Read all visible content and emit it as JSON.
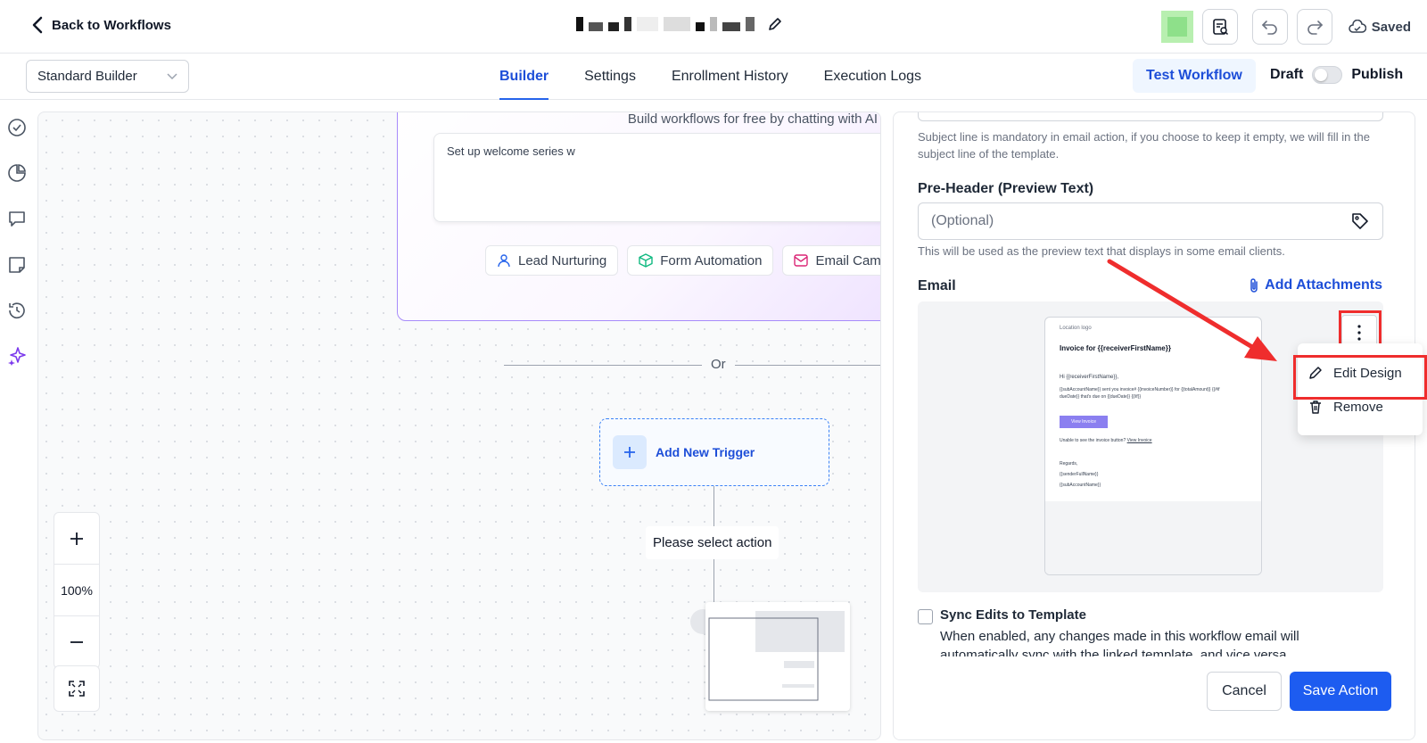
{
  "header": {
    "back_label": "Back to Workflows",
    "saved_label": "Saved",
    "brand_color": "#8ee08a"
  },
  "subbar": {
    "builder_select": "Standard Builder",
    "tabs": [
      {
        "label": "Builder",
        "active": true
      },
      {
        "label": "Settings",
        "active": false
      },
      {
        "label": "Enrollment History",
        "active": false
      },
      {
        "label": "Execution Logs",
        "active": false
      }
    ],
    "test_button": "Test Workflow",
    "draft_label": "Draft",
    "publish_label": "Publish"
  },
  "rail": {
    "icons": [
      "check-circle-icon",
      "pie-chart-icon",
      "chat-icon",
      "note-icon",
      "history-icon",
      "sparkle-icon"
    ]
  },
  "canvas": {
    "ai_subtitle": "Build workflows for free by chatting with AI",
    "ai_input_value": "Set up welcome series w",
    "chips": [
      "Lead Nurturing",
      "Form Automation",
      "Email Cam"
    ],
    "or_label": "Or",
    "add_trigger_label": "Add New Trigger",
    "select_action_label": "Please select action",
    "zoom_level": "100%"
  },
  "panel": {
    "subject_help": "Subject line is mandatory in email action, if you choose to keep it empty, we will fill in the subject line of the template.",
    "preheader_label": "Pre-Header (Preview Text)",
    "preheader_placeholder": "(Optional)",
    "preheader_help": "This will be used as the preview text that displays in some email clients.",
    "email_label": "Email",
    "add_attachments": "Add Attachments",
    "email_preview": {
      "logo_alt": "Location logo",
      "title": "Invoice for {{receiverFirstName}}",
      "greeting": "Hi {{receiverFirstName}},",
      "body_line1": "{{subAccountName}} sent you invoice# {{invoiceNumber}} for {{totalAmount}} {{#if",
      "body_line2": "dueDate}} that's due on {{dueDate}} {{/if}}",
      "button": "View Invoice",
      "unable_text": "Unable to see the invoice button?",
      "unable_link": "View Invoice",
      "regards": "Regards,",
      "sender": "{{senderFullName}}",
      "account": "{{subAccountName}}"
    },
    "menu": {
      "edit_design": "Edit Design",
      "remove": "Remove"
    },
    "sync_label": "Sync Edits to Template",
    "sync_help": "When enabled, any changes made in this workflow email will automatically sync with the linked template, and vice versa.",
    "cancel": "Cancel",
    "save": "Save Action",
    "highlight_color": "#ef2d2d",
    "primary_color": "#1d5cf0"
  }
}
